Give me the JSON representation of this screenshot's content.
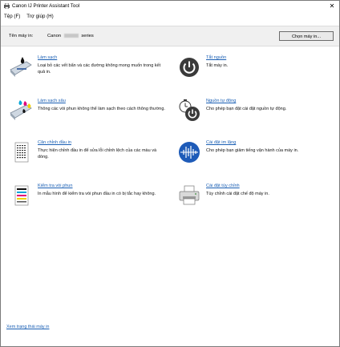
{
  "window": {
    "title": "Canon IJ Printer Assistant Tool"
  },
  "menu": [
    {
      "label": "Tệp (F)"
    },
    {
      "label": "Trợ giúp (H)"
    }
  ],
  "printer": {
    "label": "Tên máy in:",
    "name_prefix": "Canon",
    "name_suffix": "series",
    "select_button": "Chọn máy in..."
  },
  "tools": {
    "cleaning": {
      "title": "Làm sạch",
      "desc": "Loại bỏ các vết bẩn và các đường không mong muốn trong kết quả in."
    },
    "deep_cleaning": {
      "title": "Làm sạch sâu",
      "desc": "Thông các vòi phun không thể làm sạch theo cách thông thường."
    },
    "print_head_alignment": {
      "title": "Căn chỉnh đầu in",
      "desc": "Thực hiện chỉnh đầu in để sửa lỗi chỉnh lệch của các màu và dòng."
    },
    "nozzle_check": {
      "title": "Kiểm tra vòi phun",
      "desc": "In mẫu hình để kiểm tra vòi phun đầu in có bị tắc hay không."
    },
    "power_off": {
      "title": "Tắt nguồn",
      "desc": "Tắt máy in."
    },
    "auto_power": {
      "title": "Nguồn tự động",
      "desc": "Cho phép bạn đặt cài đặt nguồn tự động."
    },
    "quiet_setting": {
      "title": "Cài đặt im lặng",
      "desc": "Cho phép bạn giảm tiếng vận hành của máy in."
    },
    "custom_settings": {
      "title": "Cài đặt tùy chỉnh",
      "desc": "Tùy chỉnh cài đặt chế độ máy in."
    }
  },
  "footer": {
    "status_link": "Xem trạng thái máy in"
  }
}
